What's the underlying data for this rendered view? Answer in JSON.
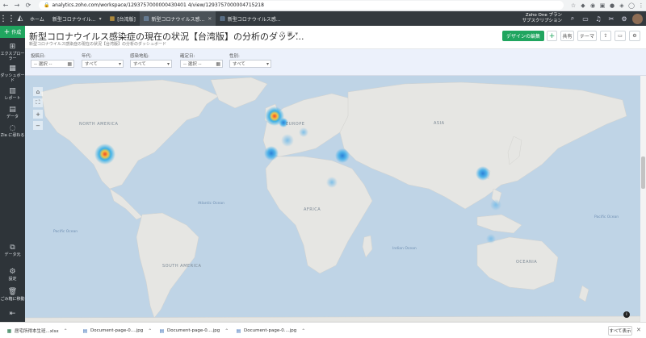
{
  "browser": {
    "url": "analytics.zoho.com/workspace/1293757000000430401 4/view/1293757000004715218"
  },
  "app_header": {
    "home_tab": "ホーム",
    "tabs": [
      {
        "label": "新型コロナウイル...",
        "icon": "chevron-down-icon"
      },
      {
        "label": "[台湾版]",
        "icon": "table-icon"
      },
      {
        "label": "新型コロナウイルス感...",
        "icon": "dashboard-icon"
      },
      {
        "label": "新型コロナウイルス感...",
        "icon": "dashboard-icon"
      }
    ],
    "plan_line1": "Zoho One プラン",
    "plan_line2": "サブスクリプション"
  },
  "left_nav": {
    "create": "作成",
    "items": [
      "エクスプローラー",
      "ダッシュボード",
      "レポート",
      "データ",
      "Zia に尋ねる"
    ],
    "bottom_items": [
      "データ元",
      "設定",
      "ごみ箱に移動"
    ]
  },
  "title": {
    "main": "新型コロナウイルス感染症の現在の状況【台湾版】の分析のダッシ...",
    "subtitle": "新型コロナウイルス感染症の現在の状況【台湾版】の分析のダッシュボード"
  },
  "toolbar": {
    "design_edit": "デザインの編集",
    "add": "+",
    "share": "共有",
    "theme": "テーマ"
  },
  "filters": [
    {
      "label": "投稿日:",
      "value": "-- 選択 --",
      "icon": "calendar-icon"
    },
    {
      "label": "年代:",
      "value": "すべて",
      "icon": "chevron-down-icon"
    },
    {
      "label": "感染地船:",
      "value": "すべて",
      "icon": "chevron-down-icon"
    },
    {
      "label": "確定日:",
      "value": "-- 選択 --",
      "icon": "calendar-icon"
    },
    {
      "label": "性別:",
      "value": "すべて",
      "icon": "chevron-down-icon"
    }
  ],
  "map": {
    "continent_labels": [
      "NORTH AMERICA",
      "EUROPE",
      "ASIA",
      "AFRICA",
      "SOUTH AMERICA",
      "OCEANIA"
    ],
    "ocean_labels": [
      "Atlantic Ocean",
      "Pacific Ocean",
      "Pacific Ocean",
      "Indian Ocean",
      "Atlantic Ocean"
    ],
    "hotspots": [
      {
        "name": "United States",
        "intensity": "high"
      },
      {
        "name": "United Kingdom",
        "intensity": "high"
      },
      {
        "name": "Netherlands",
        "intensity": "medium"
      },
      {
        "name": "Germany",
        "intensity": "low"
      },
      {
        "name": "Spain",
        "intensity": "medium"
      },
      {
        "name": "Turkey",
        "intensity": "medium"
      },
      {
        "name": "Egypt",
        "intensity": "low"
      },
      {
        "name": "Taiwan",
        "intensity": "medium"
      },
      {
        "name": "Philippines",
        "intensity": "low"
      },
      {
        "name": "Indonesia",
        "intensity": "low"
      }
    ]
  },
  "downloads": {
    "items": [
      {
        "name": "居宅所得本生班...xlsx",
        "icon": "excel-icon"
      },
      {
        "name": "Document-page-0....jpg",
        "icon": "image-icon"
      },
      {
        "name": "Document-page-0....jpg",
        "icon": "image-icon"
      },
      {
        "name": "Document-page-0....jpg",
        "icon": "image-icon"
      }
    ],
    "show_all": "すべて表示"
  }
}
